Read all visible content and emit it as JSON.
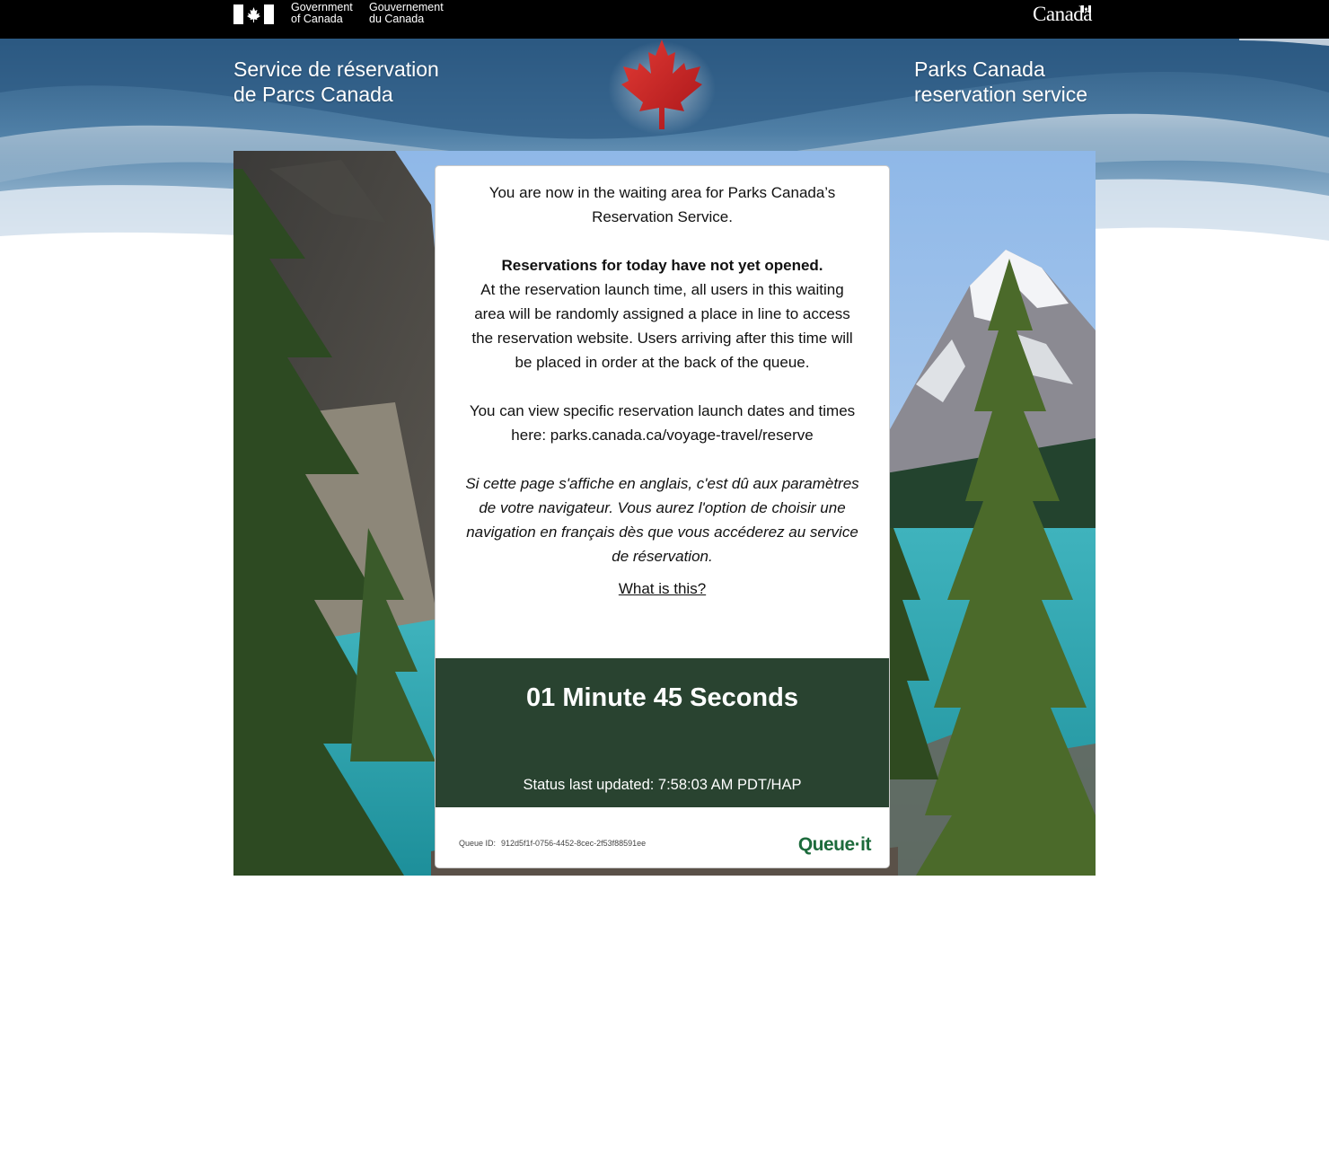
{
  "gov_bar": {
    "gov_en_line1": "Government",
    "gov_en_line2": "of Canada",
    "gov_fr_line1": "Gouvernement",
    "gov_fr_line2": "du Canada",
    "wordmark": "Canada"
  },
  "banner": {
    "title_fr_line1": "Service de réservation",
    "title_fr_line2": "de Parcs Canada",
    "title_en_line1": "Parks Canada",
    "title_en_line2": "reservation service"
  },
  "message": {
    "intro_line1": "You are now in the waiting area for Parks Canada’s",
    "intro_line2": "Reservation Service.",
    "bold_line": "Reservations for today have not yet opened.",
    "body_line1": "At the reservation launch time, all users in this waiting",
    "body_line2": "area will be randomly assigned a place in line to access",
    "body_line3": "the reservation website. Users arriving after this time will",
    "body_line4": "be placed in order at the back of the queue.",
    "dates_line1": "You can view specific reservation launch dates and times",
    "dates_line2": "here: parks.canada.ca/voyage-travel/reserve",
    "fr_line1": "Si cette page s'affiche en anglais, c'est dû aux paramètres",
    "fr_line2": "de votre navigateur. Vous aurez l'option de choisir une",
    "fr_line3": "navigation en français dès que vous accéderez au service",
    "fr_line4": "de réservation.",
    "what_link": "What is this?"
  },
  "timer": {
    "countdown": "01 Minute 45 Seconds",
    "status": "Status last updated: 7:58:03 AM PDT/HAP"
  },
  "footer": {
    "queue_id_label": "Queue ID:",
    "queue_id_value": "912d5f1f-0756-4452-8cec-2f53f88591ee",
    "logo_text": "Queue·it"
  },
  "colors": {
    "gov_bar": "#000000",
    "banner_sky": "#3f6e94",
    "timer_bg": "#294330",
    "maple_red": "#c8201f",
    "queueit_green": "#1d6b3c"
  },
  "icons": [
    "canada-flag-icon",
    "maple-leaf-icon",
    "wordmark-flag-icon"
  ]
}
